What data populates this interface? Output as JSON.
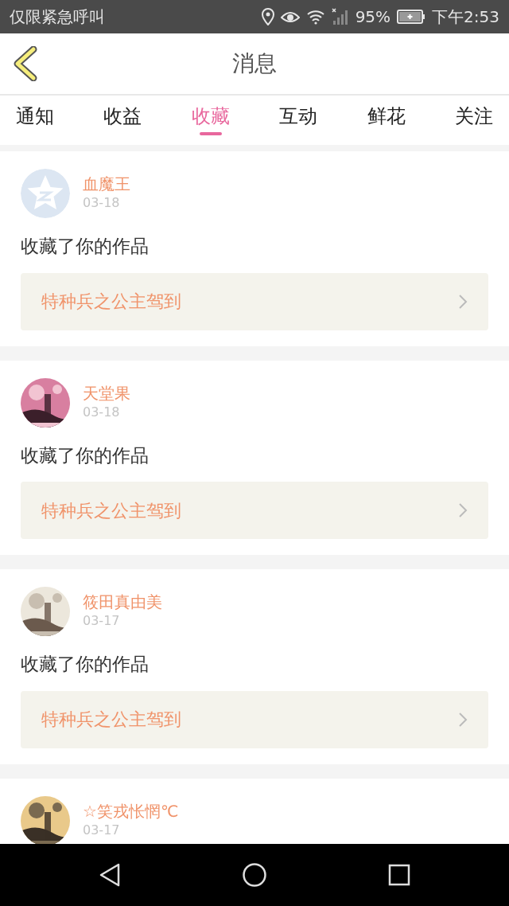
{
  "status_bar": {
    "carrier": "仅限紧急呼叫",
    "battery": "95%",
    "time": "下午2:53"
  },
  "header": {
    "title": "消息"
  },
  "tabs": [
    {
      "label": "通知",
      "selected": false
    },
    {
      "label": "收益",
      "selected": false
    },
    {
      "label": "收藏",
      "selected": true
    },
    {
      "label": "互动",
      "selected": false
    },
    {
      "label": "鲜花",
      "selected": false
    },
    {
      "label": "关注",
      "selected": false
    }
  ],
  "messages": [
    {
      "avatar": {
        "kind": "icon"
      },
      "name": "血魔王",
      "date": "03-18",
      "text": "收藏了你的作品",
      "work": "特种兵之公主驾到"
    },
    {
      "name": "天堂果",
      "date": "03-18",
      "text": "收藏了你的作品",
      "work": "特种兵之公主驾到"
    },
    {
      "name": "筱田真由美",
      "date": "03-17",
      "text": "收藏了你的作品",
      "work": "特种兵之公主驾到"
    },
    {
      "name": "☆笑戎怅惘℃",
      "date": "03-17"
    }
  ]
}
